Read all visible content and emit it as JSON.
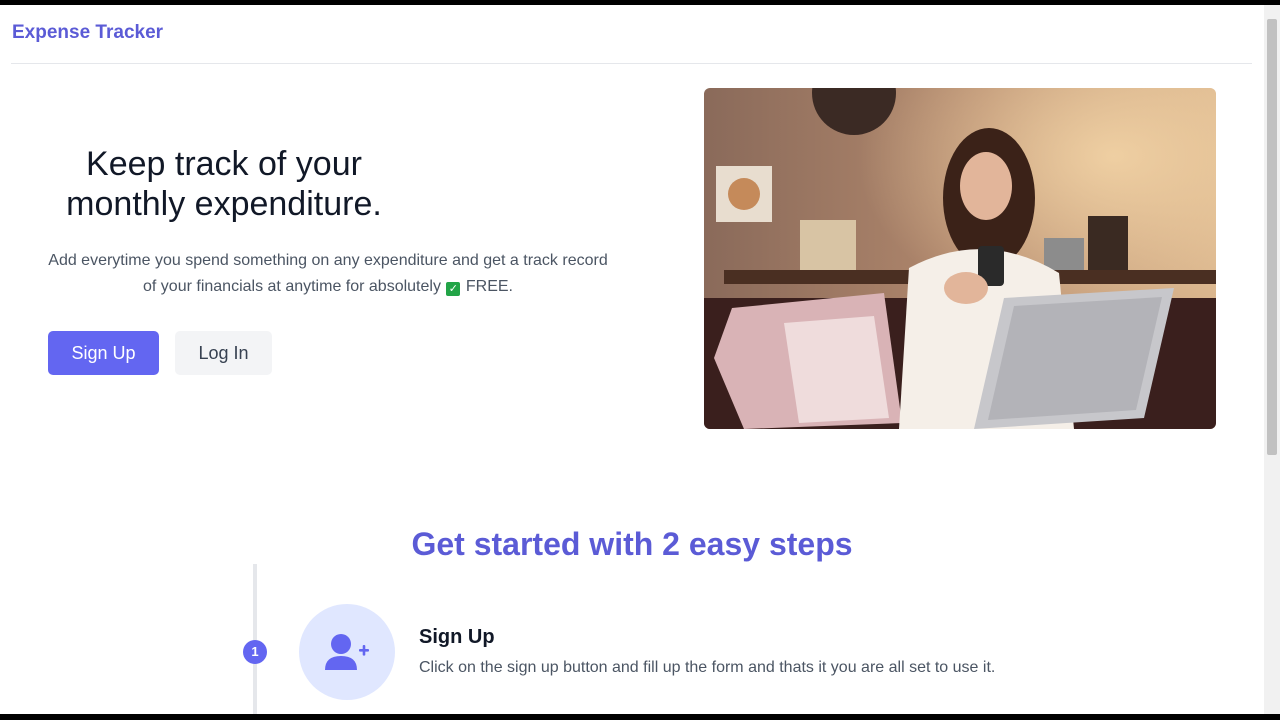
{
  "app": {
    "brand": "Expense Tracker"
  },
  "hero": {
    "title_line1": "Keep track of your",
    "title_line2": "monthly expenditure.",
    "description_part1": "Add everytime you spend something on any expenditure and get a track record of your financials at anytime for absolutely",
    "description_part2": "FREE.",
    "signup_label": "Sign Up",
    "login_label": "Log In"
  },
  "steps": {
    "heading": "Get started with 2 easy steps",
    "items": [
      {
        "number": "1",
        "title": "Sign Up",
        "description": "Click on the sign up button and fill up the form and thats it you are all set to use it."
      }
    ]
  },
  "colors": {
    "accent": "#6366f1",
    "brand_text": "#5b5bd6",
    "check": "#22a447"
  },
  "icons": {
    "step1": "user-plus-icon",
    "check": "check-box-icon"
  }
}
